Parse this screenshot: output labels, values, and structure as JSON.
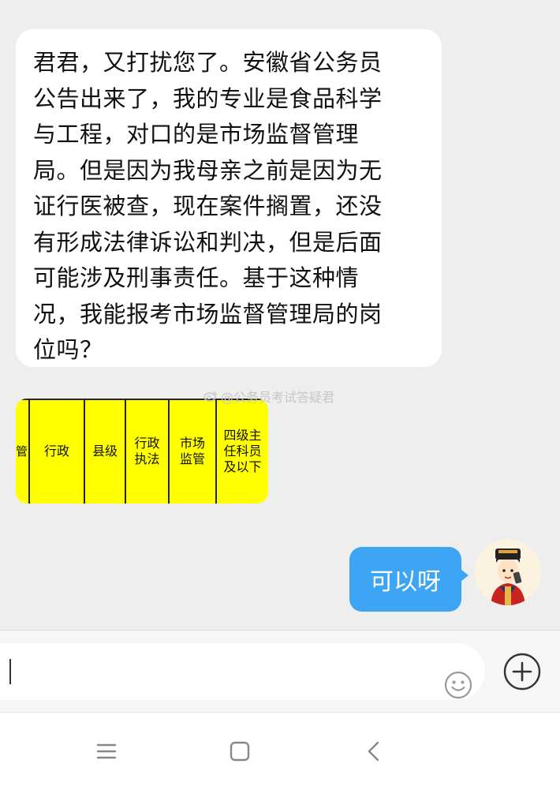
{
  "chat": {
    "incoming_text": {
      "lines": [
        "君君，又打扰您了。安徽省公务员",
        "公告出来了，我的专业是食品科学",
        "与工程，对口的是市场监督管理",
        "局。但是因为我母亲之前是因为无",
        "证行医被查，现在案件搁置，还没",
        "有形成法律诉讼和判决，但是后面",
        "可能涉及刑事责任。基于这种情",
        "况，我能报考市场监督管理局的岗",
        "位吗？"
      ]
    },
    "incoming_image": {
      "cells": [
        [
          "管"
        ],
        [
          "行政"
        ],
        [
          "县级"
        ],
        [
          "行政",
          "执法"
        ],
        [
          "市场",
          "监管"
        ],
        [
          "四级主",
          "任科员",
          "及以下"
        ]
      ],
      "background_color": "#ffff00"
    },
    "watermark": "@公务员考试答疑君",
    "outgoing_text": "可以呀",
    "outgoing_color": "#3ea5f5"
  },
  "input": {
    "value": "",
    "emoji_icon": "smiley-icon",
    "plus_icon": "plus-circle-icon"
  },
  "nav": {
    "menu_icon": "menu-icon",
    "home_icon": "home-square-icon",
    "back_icon": "back-chevron-icon"
  }
}
